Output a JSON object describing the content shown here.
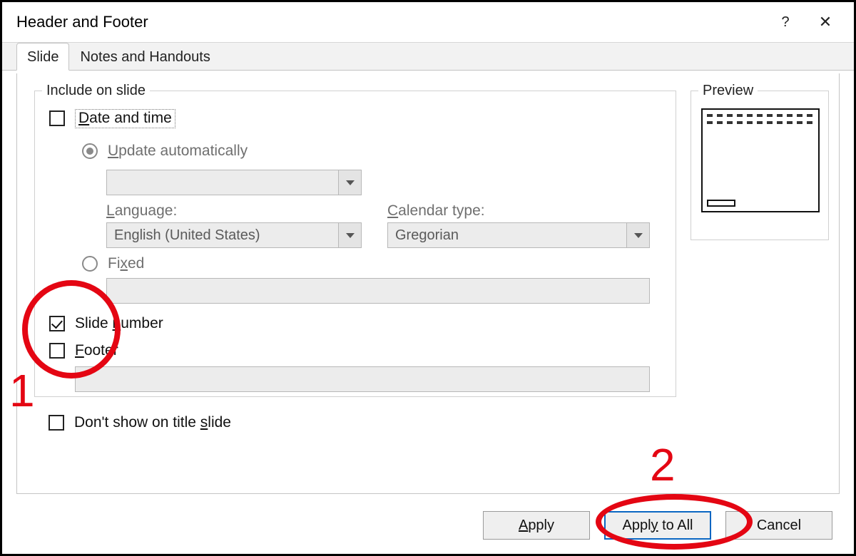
{
  "titlebar": {
    "title": "Header and Footer",
    "help_label": "?",
    "close_label": "✕"
  },
  "tabs": {
    "slide": "Slide",
    "notes": "Notes and Handouts"
  },
  "include": {
    "legend": "Include on slide",
    "date_time": "Date and time",
    "update_auto": "Update automatically",
    "language_label": "Language:",
    "language_value": "English (United States)",
    "calendar_label": "Calendar type:",
    "calendar_value": "Gregorian",
    "fixed": "Fixed",
    "slide_number": "Slide number",
    "footer": "Footer",
    "no_title_slide": "Don't show on title slide"
  },
  "preview": {
    "legend": "Preview"
  },
  "buttons": {
    "apply": "Apply",
    "apply_all": "Apply to All",
    "cancel": "Cancel"
  },
  "annotations": {
    "step1": "1",
    "step2": "2"
  }
}
